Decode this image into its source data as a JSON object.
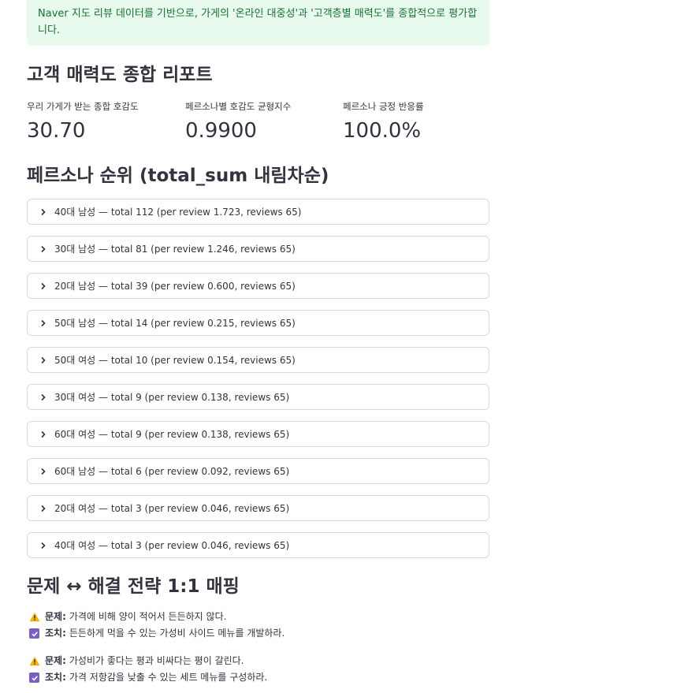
{
  "info": {
    "text": "Naver 지도 리뷰 데이터를 기반으로, 가게의 '온라인 대중성'과 '고객층별 매력도'를 종합적으로 평가합니다."
  },
  "report": {
    "title": "고객 매력도 종합 리포트",
    "metrics": [
      {
        "label": "우리 가게가 받는 종합 호감도",
        "value": "30.70"
      },
      {
        "label": "페르소나별 호감도 균형지수",
        "value": "0.9900"
      },
      {
        "label": "페르소나 긍정 반응률",
        "value": "100.0%"
      }
    ]
  },
  "ranking": {
    "title": "페르소나 순위 (total_sum 내림차순)",
    "items": [
      {
        "label": "40대 남성 — total 112 (per review 1.723, reviews 65)"
      },
      {
        "label": "30대 남성 — total 81 (per review 1.246, reviews 65)"
      },
      {
        "label": "20대 남성 — total 39 (per review 0.600, reviews 65)"
      },
      {
        "label": "50대 남성 — total 14 (per review 0.215, reviews 65)"
      },
      {
        "label": "50대 여성 — total 10 (per review 0.154, reviews 65)"
      },
      {
        "label": "30대 여성 — total 9 (per review 0.138, reviews 65)"
      },
      {
        "label": "60대 여성 — total 9 (per review 0.138, reviews 65)"
      },
      {
        "label": "60대 남성 — total 6 (per review 0.092, reviews 65)"
      },
      {
        "label": "20대 여성 — total 3 (per review 0.046, reviews 65)"
      },
      {
        "label": "40대 여성 — total 3 (per review 0.046, reviews 65)"
      }
    ]
  },
  "mapping": {
    "title": "문제 ↔ 해결 전략 1:1 매핑",
    "problem_tag": "문제:",
    "action_tag": "조치:",
    "pairs": [
      {
        "problem": "가격에 비해 양이 적어서 든든하지 않다.",
        "action": "든든하게 먹을 수 있는 가성비 사이드 메뉴를 개발하라."
      },
      {
        "problem": "가성비가 좋다는 평과 비싸다는 평이 갈린다.",
        "action": "가격 저항감을 낮출 수 있는 세트 메뉴를 구성하라."
      }
    ]
  },
  "icons": {
    "expander": "chevron-right-icon",
    "problem": "warning-icon",
    "action": "check-box-icon"
  },
  "colors": {
    "info_bg": "#e8f9ee",
    "info_text": "#177233",
    "check": "#7b5fc4",
    "warning": "#f4b400"
  }
}
